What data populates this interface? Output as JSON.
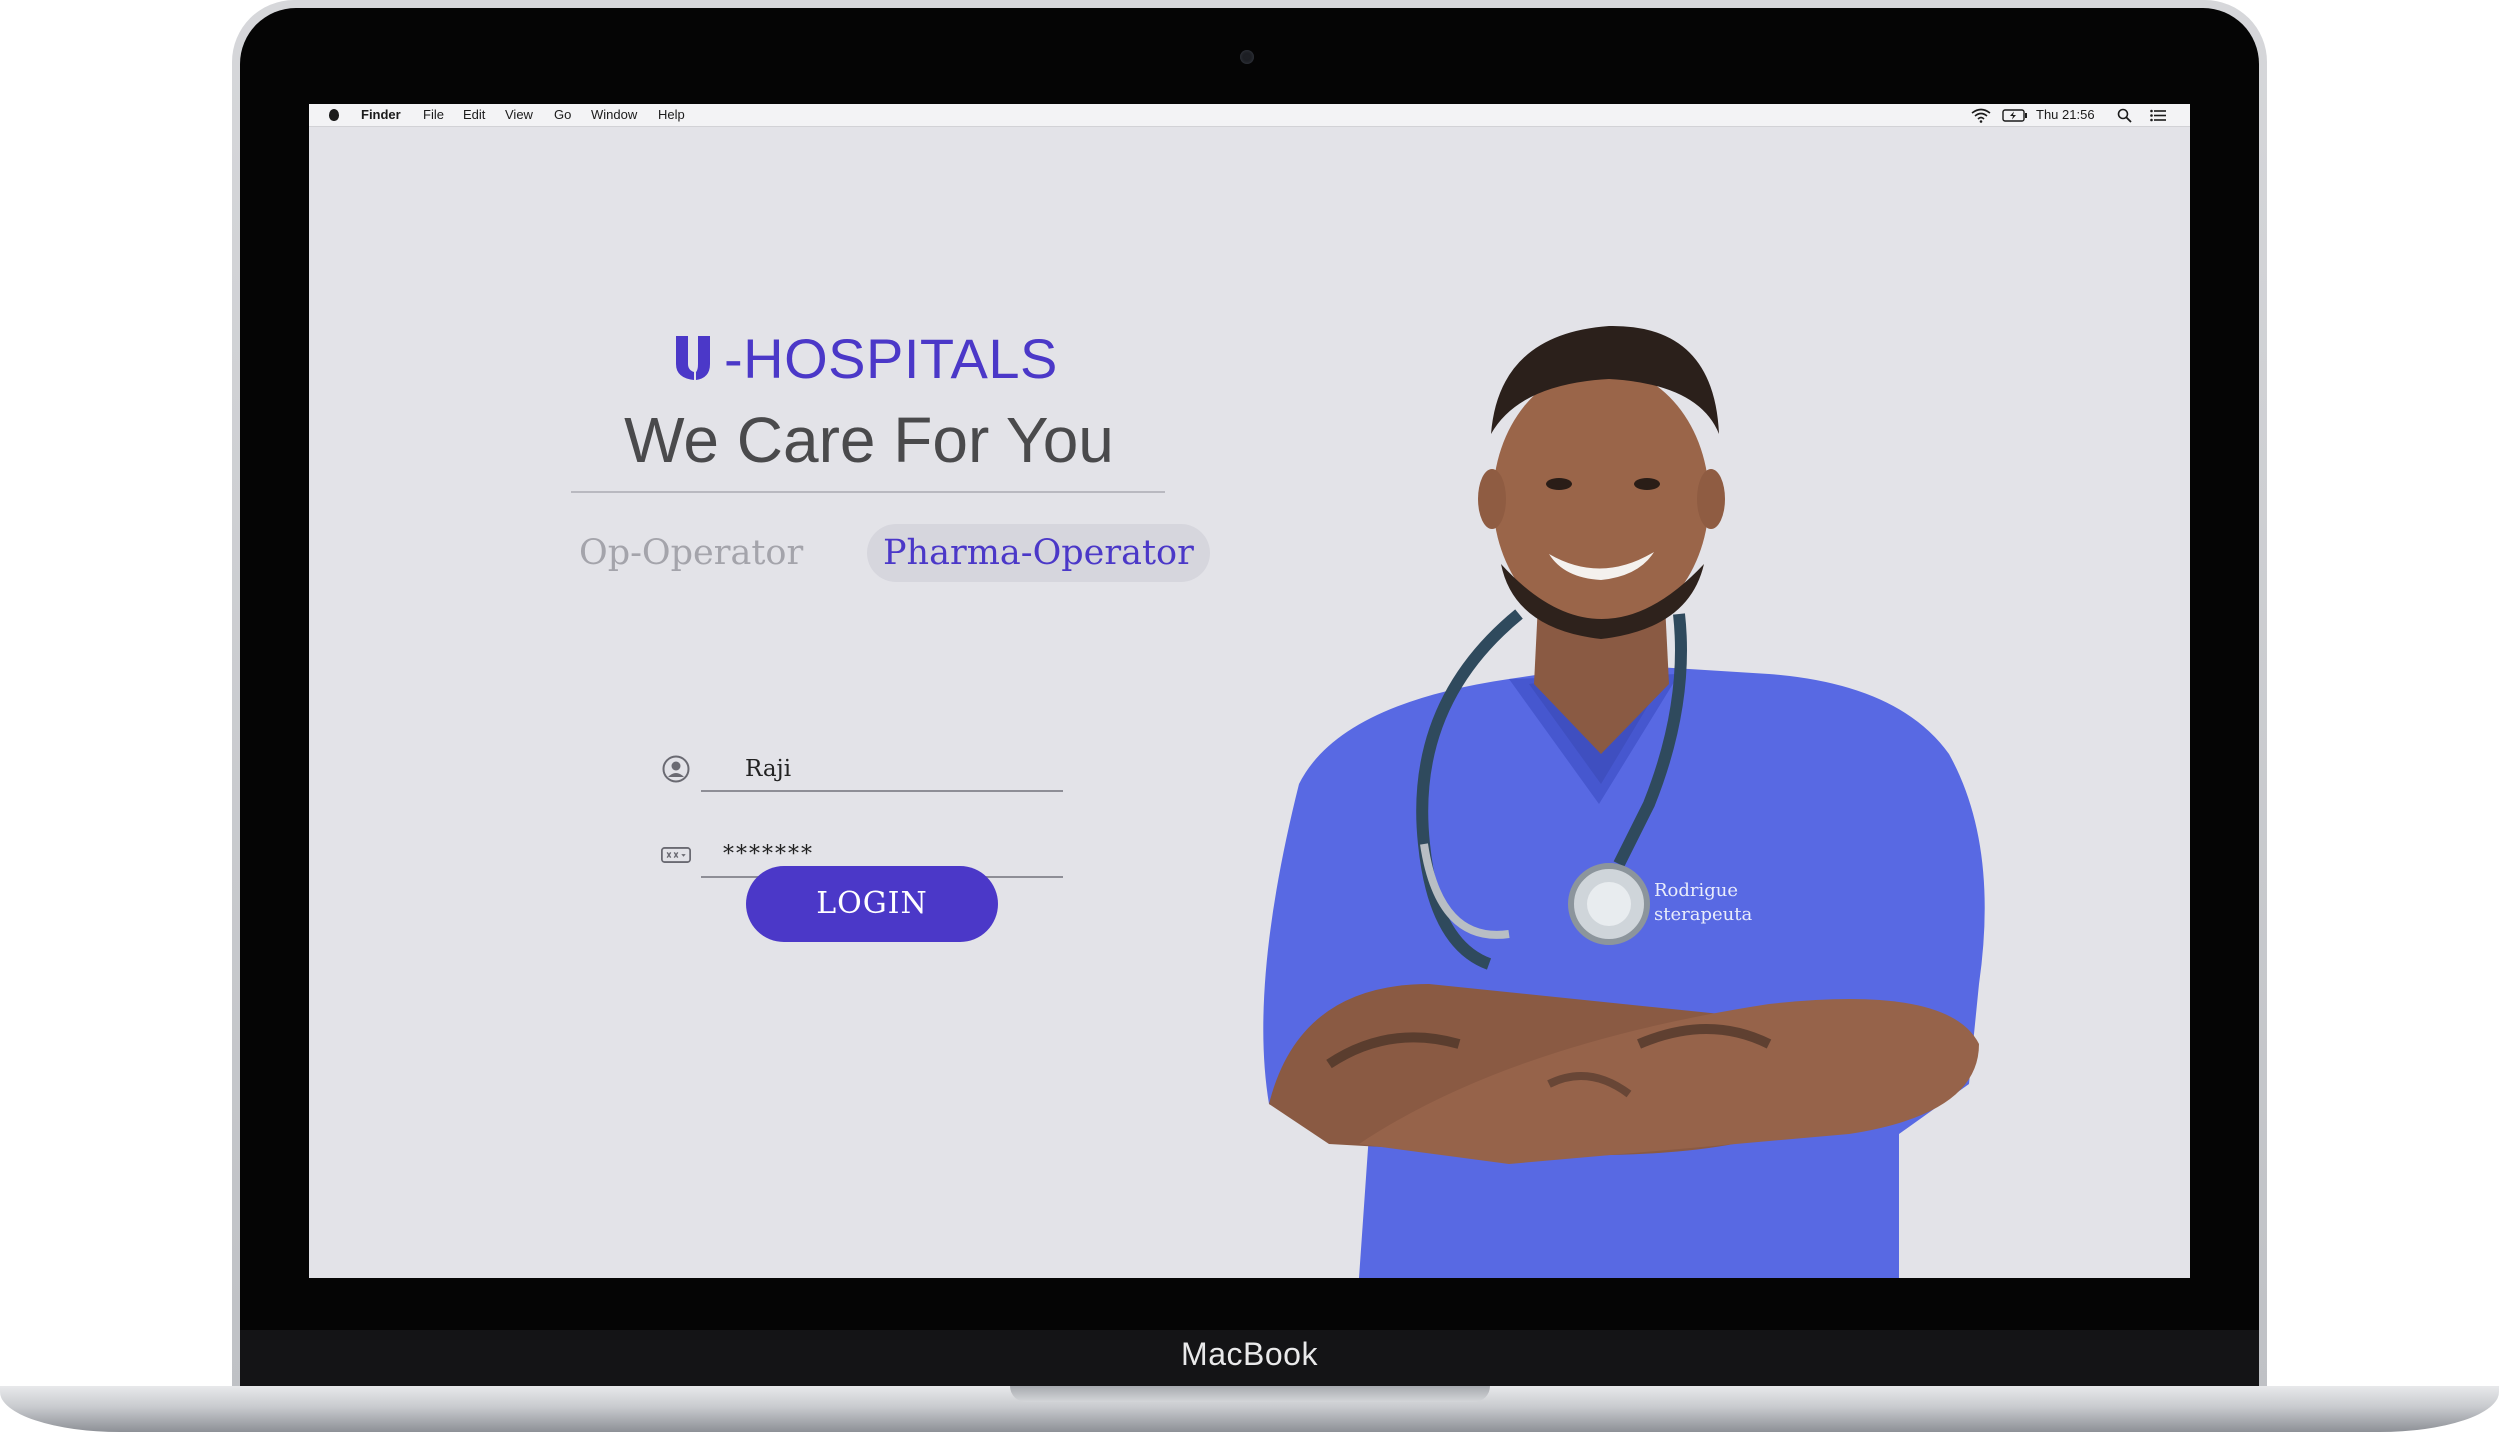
{
  "device": {
    "brand_label": "MacBook"
  },
  "menubar": {
    "app_name": "Finder",
    "menus": [
      "File",
      "Edit",
      "View",
      "Go",
      "Window",
      "Help"
    ],
    "clock": "Thu 21:56"
  },
  "login": {
    "brand": "-HOSPITALS",
    "tagline": "We Care For You",
    "tabs": [
      {
        "label": "Op-Operator",
        "selected": false
      },
      {
        "label": "Pharma-Operator",
        "selected": true
      }
    ],
    "username": "Raji",
    "password_masked": "*******",
    "login_button": "LOGIN"
  },
  "illustration": {
    "badge_text_1": "Rodrigue",
    "badge_text_2": "sterapeuta"
  },
  "colors": {
    "accent": "#4b38c8",
    "screen_bg": "#e3e3e8",
    "scrubs": "#5869e3"
  },
  "icons": [
    "apple-icon",
    "wifi-icon",
    "battery-icon",
    "search-icon",
    "list-icon",
    "user-icon",
    "password-icon",
    "hospital-logo-icon"
  ]
}
